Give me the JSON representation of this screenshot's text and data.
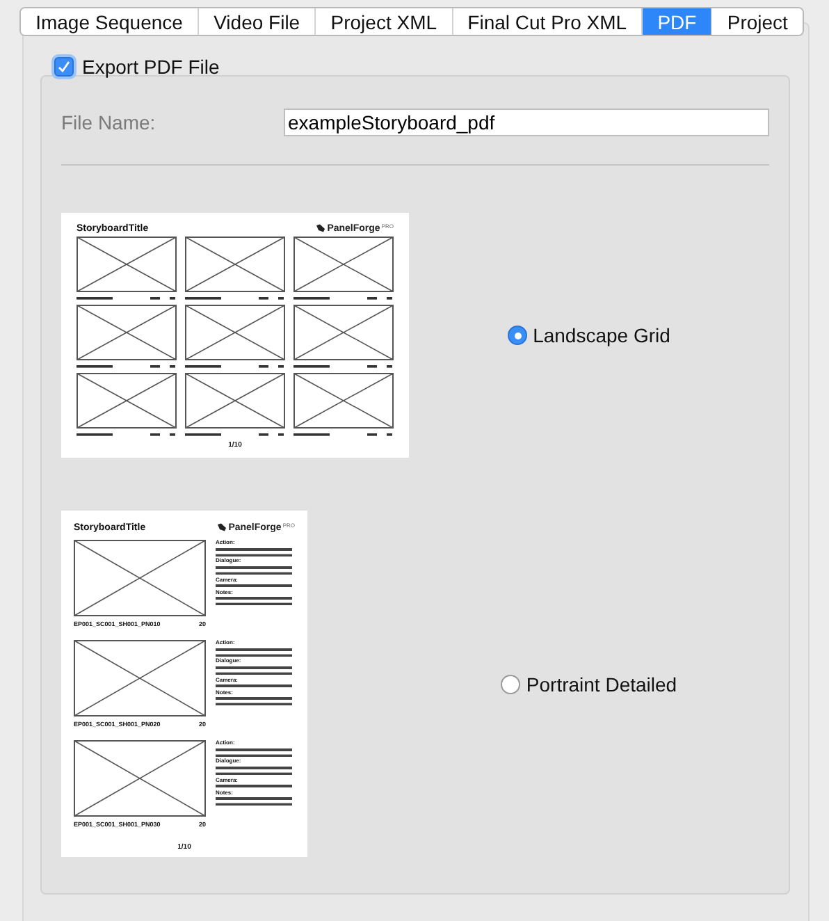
{
  "tabs": [
    {
      "label": "Image Sequence",
      "selected": false
    },
    {
      "label": "Video File",
      "selected": false
    },
    {
      "label": "Project XML",
      "selected": false
    },
    {
      "label": "Final Cut Pro XML",
      "selected": false
    },
    {
      "label": "PDF",
      "selected": true
    },
    {
      "label": "Project",
      "selected": false
    }
  ],
  "export_checkbox": {
    "label": "Export PDF File",
    "checked": true
  },
  "file_name": {
    "label": "File Name:",
    "value": "exampleStoryboard_pdf"
  },
  "layouts": [
    {
      "kind": "grid",
      "label": "Landscape Grid",
      "selected": true,
      "preview": {
        "title": "StoryboardTitle",
        "logo": "PanelForge",
        "logo_badge": "PRO",
        "page": "1/10"
      }
    },
    {
      "kind": "detailed",
      "label": "Portraint Detailed",
      "selected": false,
      "preview": {
        "title": "StoryboardTitle",
        "logo": "PanelForge",
        "logo_badge": "PRO",
        "page": "1/10",
        "panels": [
          {
            "name": "EP001_SC001_SH001_PN010",
            "duration": "20",
            "section_labels": [
              "Action:",
              "Dialogue:",
              "Camera:",
              "Notes:"
            ]
          },
          {
            "name": "EP001_SC001_SH001_PN020",
            "duration": "20",
            "section_labels": [
              "Action:",
              "Dialogue:",
              "Camera:",
              "Notes:"
            ]
          },
          {
            "name": "EP001_SC001_SH001_PN030",
            "duration": "20",
            "section_labels": [
              "Action:",
              "Dialogue:",
              "Camera:",
              "Notes:"
            ]
          }
        ]
      }
    }
  ]
}
